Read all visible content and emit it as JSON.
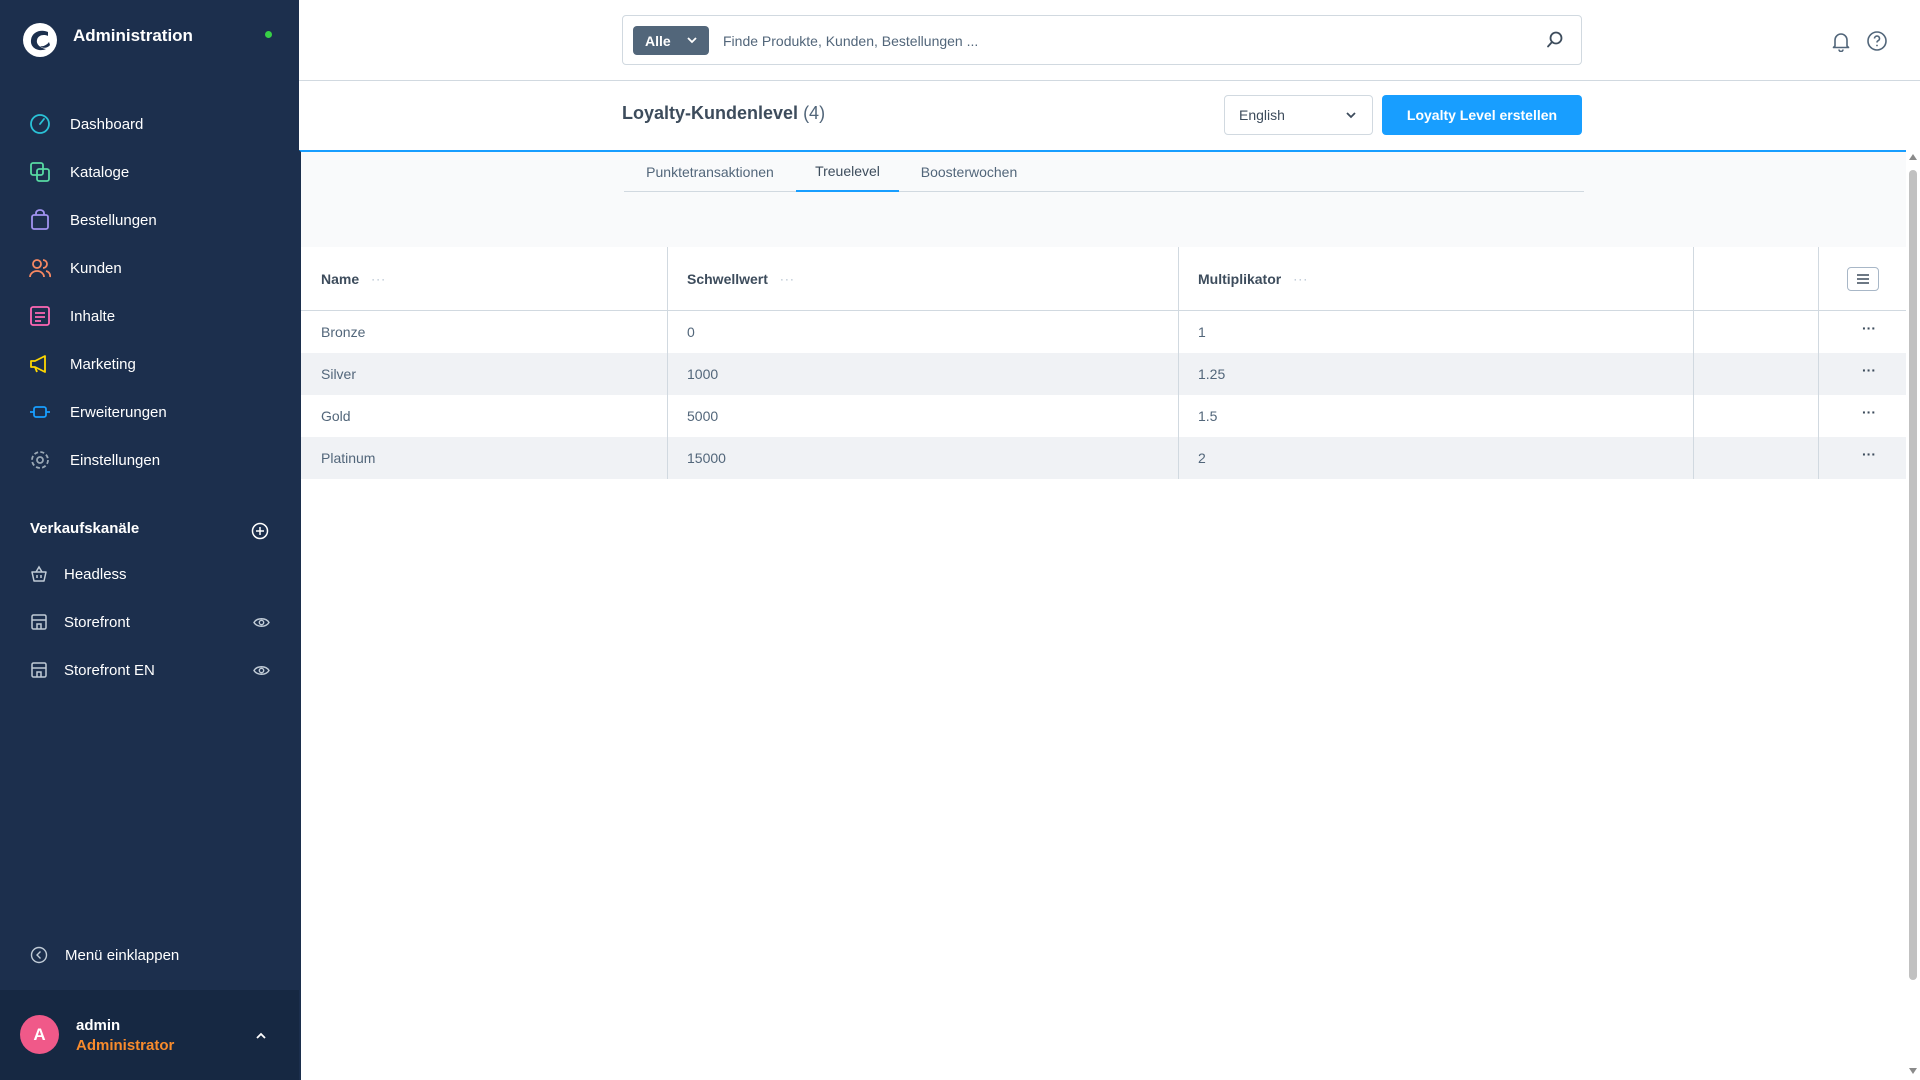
{
  "sidebar": {
    "brand_title": "Administration",
    "nav": [
      {
        "label": "Dashboard",
        "icon": "dashboard-icon",
        "color": "#2ac2d7"
      },
      {
        "label": "Kataloge",
        "icon": "catalog-icon",
        "color": "#57d9a3"
      },
      {
        "label": "Bestellungen",
        "icon": "orders-icon",
        "color": "#a092f0"
      },
      {
        "label": "Kunden",
        "icon": "customers-icon",
        "color": "#f88962"
      },
      {
        "label": "Inhalte",
        "icon": "content-icon",
        "color": "#ff68b4"
      },
      {
        "label": "Marketing",
        "icon": "marketing-icon",
        "color": "#ffd700"
      },
      {
        "label": "Erweiterungen",
        "icon": "extensions-icon",
        "color": "#189eff"
      },
      {
        "label": "Einstellungen",
        "icon": "settings-icon",
        "color": "#9aa8b5"
      }
    ],
    "channels_title": "Verkaufskanäle",
    "channels": [
      {
        "label": "Headless"
      },
      {
        "label": "Storefront"
      },
      {
        "label": "Storefront EN"
      }
    ],
    "collapse_label": "Menü einklappen",
    "user": {
      "initial": "A",
      "name": "admin",
      "role": "Administrator"
    }
  },
  "search": {
    "type_label": "Alle",
    "placeholder": "Finde Produkte, Kunden, Bestellungen ..."
  },
  "header": {
    "title": "Loyalty-Kundenlevel",
    "count": "(4)",
    "language": "English",
    "create_label": "Loyalty Level erstellen"
  },
  "tabs": [
    {
      "label": "Punktetransaktionen",
      "active": false
    },
    {
      "label": "Treuelevel",
      "active": true
    },
    {
      "label": "Boosterwochen",
      "active": false
    }
  ],
  "grid": {
    "columns": [
      "Name",
      "Schwellwert",
      "Multiplikator"
    ],
    "more_symbol": "···",
    "rows": [
      {
        "name": "Bronze",
        "threshold": "0",
        "multiplier": "1"
      },
      {
        "name": "Silver",
        "threshold": "1000",
        "multiplier": "1.25"
      },
      {
        "name": "Gold",
        "threshold": "5000",
        "multiplier": "1.5"
      },
      {
        "name": "Platinum",
        "threshold": "15000",
        "multiplier": "2"
      }
    ],
    "row_action_symbol": "···"
  },
  "colors": {
    "sidebar_bg": "#1c2f4d",
    "accent": "#189eff",
    "status_online": "#37d046",
    "avatar": "#f05989",
    "role": "#f88b2c"
  }
}
